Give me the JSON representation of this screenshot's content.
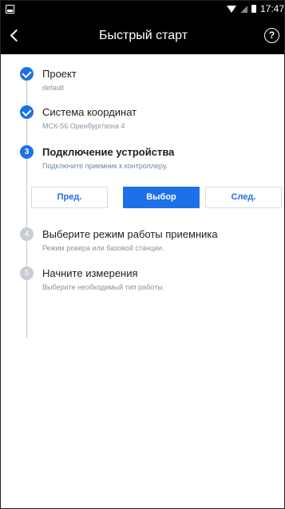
{
  "status_bar": {
    "time": "17:47"
  },
  "header": {
    "title": "Быстрый старт",
    "help_label": "?"
  },
  "steps": [
    {
      "number": "1",
      "title": "Проект",
      "subtitle": "default",
      "state": "done"
    },
    {
      "number": "2",
      "title": "Система координат",
      "subtitle": "МСК-56 Оренбург/зона 4",
      "state": "done"
    },
    {
      "number": "3",
      "title": "Подключение устройства",
      "subtitle": "Подключите приемник к контроллеру.",
      "state": "active"
    },
    {
      "number": "4",
      "title": "Выберите режим работы приемника",
      "subtitle": "Режим ровера или базовой станции.",
      "state": "todo"
    },
    {
      "number": "5",
      "title": "Начните измерения",
      "subtitle": "Выберите необходимый тип работы.",
      "state": "todo"
    }
  ],
  "buttons": {
    "prev": "Пред.",
    "select": "Выбор",
    "next": "След."
  },
  "colors": {
    "accent": "#1e70e6",
    "inactive": "#c8ccd3",
    "header_bg": "#000000"
  }
}
